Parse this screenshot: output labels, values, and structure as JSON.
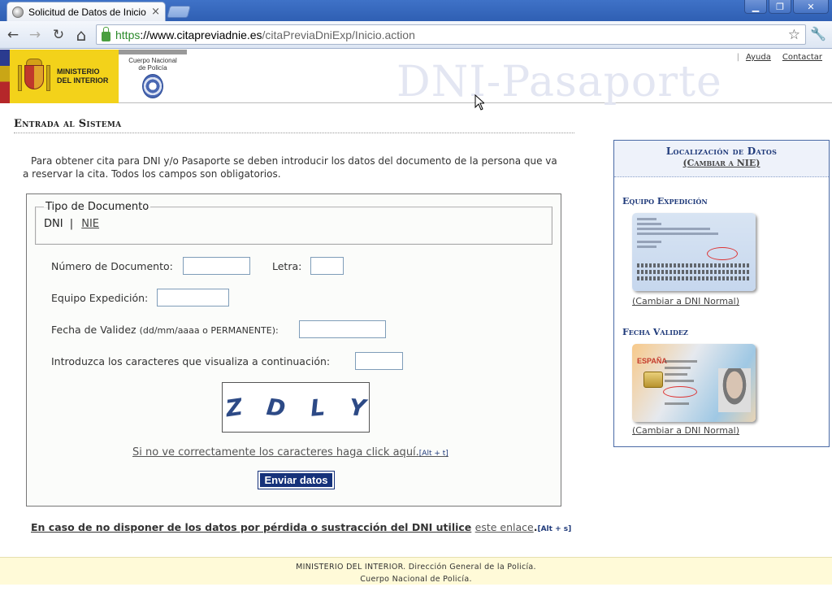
{
  "browser": {
    "tab_title": "Solicitud de Datos de Inicio de",
    "tab_close": "×",
    "url_scheme": "https",
    "url_host": "://www.citapreviadnie.es",
    "url_path": "/citaPreviaDniExp/Inicio.action",
    "window_buttons": {
      "minimize": "▁",
      "maximize": "❐",
      "close": "✕"
    },
    "nav": {
      "back": "←",
      "forward": "→",
      "reload": "↻",
      "home": "⌂",
      "star": "☆",
      "wrench": "🔧"
    }
  },
  "header": {
    "ministry": "MINISTERIO DEL INTERIOR",
    "police_line1": "Cuerpo Nacional",
    "police_line2": "de Policía",
    "banner_text": "DNI-Pasaporte",
    "links": {
      "help": "Ayuda",
      "contact": "Contactar"
    }
  },
  "main": {
    "title": "Entrada al Sistema",
    "intro": "Para obtener cita para DNI y/o Pasaporte se deben introducir los datos del documento de la persona que va a reservar la cita. Todos los campos son obligatorios.",
    "doc_type": {
      "legend": "Tipo de Documento",
      "dni": "DNI",
      "separator": "|",
      "nie": "NIE"
    },
    "fields": {
      "doc_number_label": "Número de Documento:",
      "doc_number_value": "",
      "letter_label": "Letra:",
      "letter_value": "",
      "team_label": "Equipo Expedición:",
      "team_value": "",
      "validity_label": "Fecha de Validez",
      "validity_hint": "(dd/mm/aaaa o PERMANENTE):",
      "validity_value": "",
      "captcha_label": "Introduzca los caracteres que visualiza a continuación:",
      "captcha_value": ""
    },
    "captcha_chars": [
      "Z",
      "D",
      "L",
      "Y"
    ],
    "captcha_link": "Si no ve correctamente los caracteres haga click aquí.",
    "captcha_accesskey": "[Alt + t]",
    "submit": "Enviar datos",
    "loss_text": "En caso de no disponer de los datos por pérdida o sustracción del DNI utilice",
    "loss_link": "este enlace",
    "loss_period": ".",
    "loss_accesskey": "[Alt + s]"
  },
  "side": {
    "title": "Localización de Datos",
    "change": "(Cambiar a NIE)",
    "section1": "Equipo Expedición",
    "link1": "(Cambiar a DNI Normal)",
    "section2": "Fecha Validez",
    "card_country": "ESPAÑA",
    "link2": "(Cambiar a DNI Normal)"
  },
  "footer": {
    "line1": "MINISTERIO DEL INTERIOR. Dirección General de la Policía.",
    "line2": "Cuerpo Nacional de Policía."
  },
  "colors": {
    "accent": "#16327a",
    "side_border": "#4a6aa6",
    "footer_bg": "#fffad8"
  }
}
